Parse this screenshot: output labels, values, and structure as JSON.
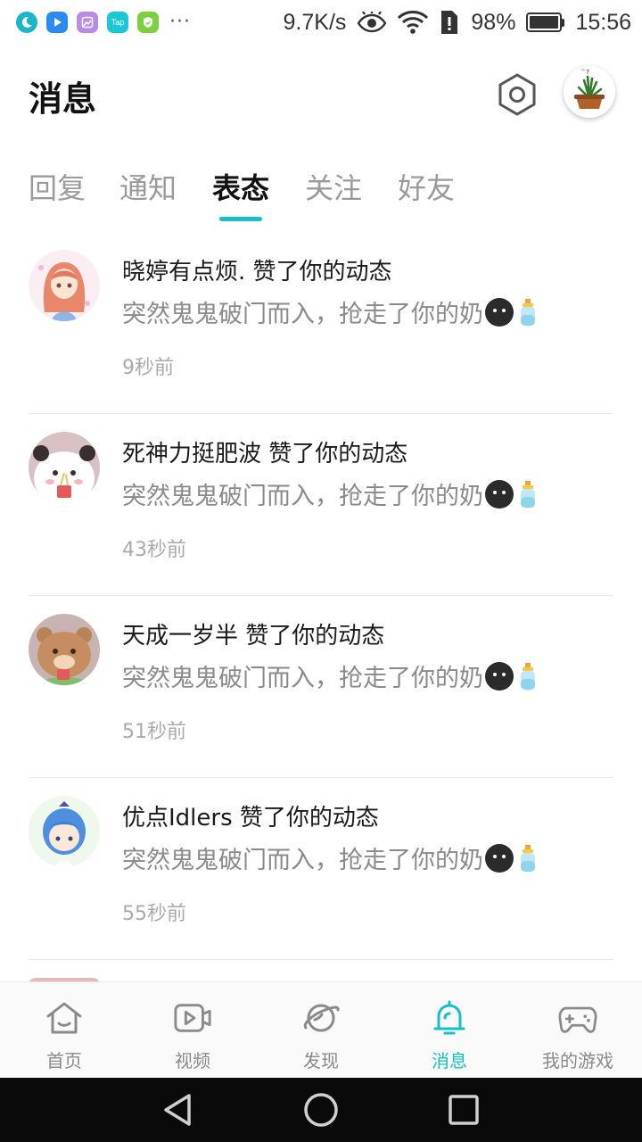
{
  "status_bar": {
    "net_speed": "9.7K/s",
    "battery": "98%",
    "battery_level": 0.98,
    "time": "15:56",
    "more": "···",
    "tap_app_label": "Tap"
  },
  "header": {
    "title": "消息"
  },
  "tabs": [
    {
      "label": "回复",
      "active": false
    },
    {
      "label": "通知",
      "active": false
    },
    {
      "label": "表态",
      "active": true
    },
    {
      "label": "关注",
      "active": false
    },
    {
      "label": "好友",
      "active": false
    }
  ],
  "messages": [
    {
      "title": "晓婷有点烦. 赞了你的动态",
      "content": "突然鬼鬼破门而入，抢走了你的奶",
      "time": "9秒前"
    },
    {
      "title": "死神力挺肥波 赞了你的动态",
      "content": "突然鬼鬼破门而入，抢走了你的奶",
      "time": "43秒前"
    },
    {
      "title": "天成一岁半 赞了你的动态",
      "content": "突然鬼鬼破门而入，抢走了你的奶",
      "time": "51秒前"
    },
    {
      "title": "优点Idlers 赞了你的动态",
      "content": "突然鬼鬼破门而入，抢走了你的奶",
      "time": "55秒前"
    }
  ],
  "bottom_nav": [
    {
      "label": "首页",
      "icon": "home-icon",
      "active": false
    },
    {
      "label": "视频",
      "icon": "video-icon",
      "active": false
    },
    {
      "label": "发现",
      "icon": "planet-icon",
      "active": false
    },
    {
      "label": "消息",
      "icon": "bell-icon",
      "active": true
    },
    {
      "label": "我的游戏",
      "icon": "gamepad-icon",
      "active": false
    }
  ],
  "colors": {
    "accent": "#16c0c6",
    "inactive": "#8a8a8a"
  }
}
